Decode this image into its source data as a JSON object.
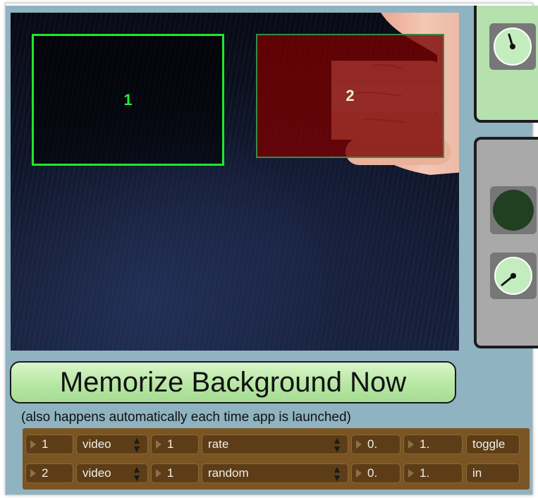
{
  "video": {
    "zone1_label": "1",
    "zone2_label": "2"
  },
  "memorize": {
    "label": "Memorize Background Now",
    "note": "(also happens automatically each time app is launched)"
  },
  "rows": [
    {
      "number": "1",
      "source": "video",
      "channel": "1",
      "mode": "rate",
      "min": "0.",
      "max": "1.",
      "action": "toggle"
    },
    {
      "number": "2",
      "source": "video",
      "channel": "1",
      "mode": "random",
      "min": "0.",
      "max": "1.",
      "action": "in"
    }
  ],
  "colors": {
    "accent_green": "#1fe82a",
    "button_green": "#b7e7a4",
    "row_bg": "#7a5523",
    "patcher_bg": "#8fb3c0",
    "led": "#213f21"
  },
  "icons": {
    "menu_arrows": "up-down-arrows-icon",
    "number_triangle": "triangle-right-icon"
  }
}
